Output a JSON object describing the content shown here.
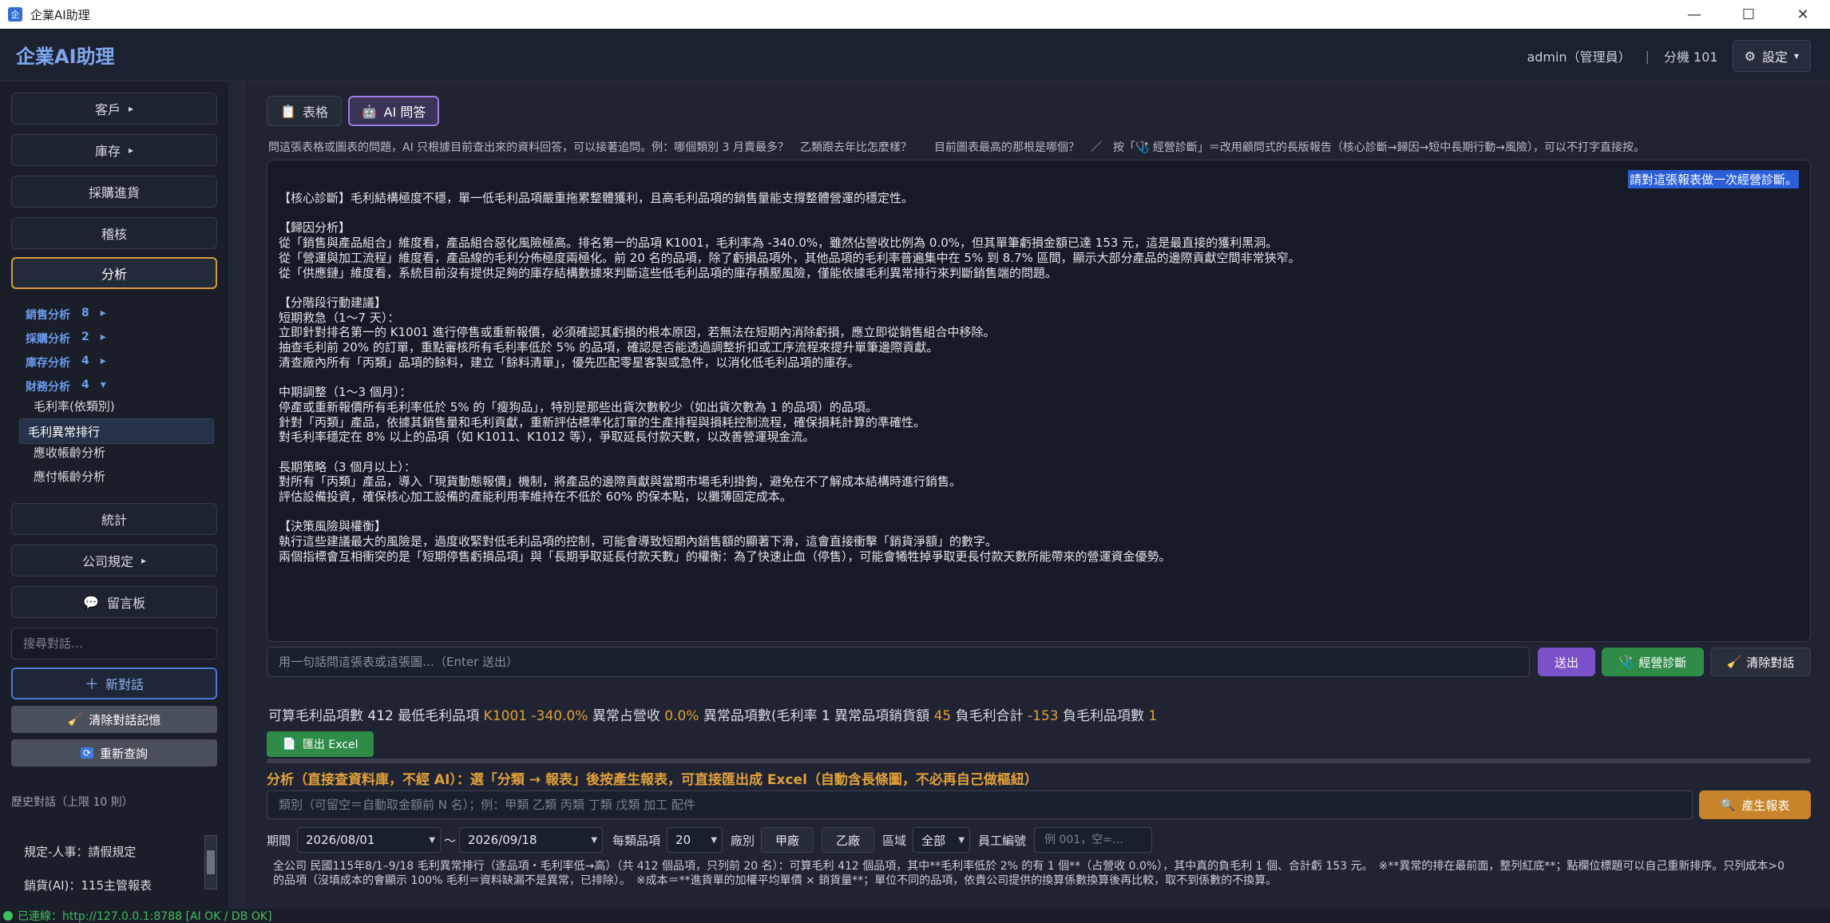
{
  "window": {
    "title": "企業AI助理"
  },
  "header": {
    "brand": "企業AI助理",
    "user": "admin（管理員）",
    "separator": "|",
    "branch": "分機 101",
    "settings_label": "設定",
    "settings_caret": "▾"
  },
  "sidebar": {
    "nav": [
      {
        "label": "客戶",
        "caret": "▸"
      },
      {
        "label": "庫存",
        "caret": "▸"
      },
      {
        "label": "採購進貨",
        "caret": ""
      },
      {
        "label": "稽核",
        "caret": ""
      },
      {
        "label": "分析",
        "caret": ""
      }
    ],
    "sub_groups": [
      {
        "label": "銷售分析",
        "count": "8",
        "caret": "▸"
      },
      {
        "label": "採購分析",
        "count": "2",
        "caret": "▸"
      },
      {
        "label": "庫存分析",
        "count": "4",
        "caret": "▸"
      },
      {
        "label": "財務分析",
        "count": "4",
        "caret": "▾"
      }
    ],
    "sub_items": [
      "毛利率(依類別)",
      "毛利異常排行",
      "應收帳齡分析",
      "應付帳齡分析"
    ],
    "nav2": [
      {
        "label": "統計",
        "caret": ""
      },
      {
        "label": "公司規定",
        "caret": "▸"
      },
      {
        "label": "留言板",
        "caret": ""
      }
    ],
    "search_placeholder": "搜尋對話…",
    "new_chat": "新對話",
    "clear_memory": "清除對話記憶",
    "requery": "重新查詢",
    "history_title": "歷史對話（上限 10 則）",
    "history": [
      "規定-人事：請假規定",
      "銷貨(AI)：115主管報表"
    ]
  },
  "main": {
    "tabs": [
      "表格",
      "AI 問答"
    ],
    "hint": "問這張表格或圖表的問題，AI 只根據目前查出來的資料回答，可以接著追問。例：哪個類別 3 月賣最多？　乙類跟去年比怎麼樣？　　目前圖表最高的那根是哪個？　／　按「🩺 經營診斷」＝改用顧問式的長版報告（核心診斷→歸因→短中長期行動→風險），可以不打字直接按。",
    "user_message": "請對這張報表做一次經營診斷。",
    "ai_lines": [
      "【核心診斷】毛利結構極度不穩，單一低毛利品項嚴重拖累整體獲利，且高毛利品項的銷售量能支撐整體營運的穩定性。",
      "",
      "【歸因分析】",
      "從「銷售與產品組合」維度看，產品組合惡化風險極高。排名第一的品項 K1001，毛利率為 -340.0%，雖然佔營收比例為 0.0%，但其單筆虧損金額已達 153 元，這是最直接的獲利黑洞。",
      "從「營運與加工流程」維度看，產品線的毛利分佈極度兩極化。前 20 名的品項，除了虧損品項外，其他品項的毛利率普遍集中在 5% 到 8.7% 區間，顯示大部分產品的邊際貢獻空間非常狹窄。",
      "從「供應鏈」維度看，系統目前沒有提供足夠的庫存結構數據來判斷這些低毛利品項的庫存積壓風險，僅能依據毛利異常排行來判斷銷售端的問題。",
      "",
      "【分階段行動建議】",
      "短期救急（1～7 天）：",
      "立即針對排名第一的 K1001 進行停售或重新報價，必須確認其虧損的根本原因，若無法在短期內消除虧損，應立即從銷售組合中移除。",
      "抽查毛利前 20% 的訂單，重點審核所有毛利率低於 5% 的品項，確認是否能透過調整折扣或工序流程來提升單筆邊際貢獻。",
      "清查廠內所有「丙類」品項的餘料，建立「餘料清單」，優先匹配零星客製或急件，以消化低毛利品項的庫存。",
      "",
      "中期調整（1～3 個月）：",
      "停產或重新報價所有毛利率低於 5% 的「瘦狗品」，特別是那些出貨次數較少（如出貨次數為 1 的品項）的品項。",
      "針對「丙類」產品，依據其銷售量和毛利貢獻，重新評估標準化訂單的生產排程與損耗控制流程，確保損耗計算的準確性。",
      "對毛利率穩定在 8% 以上的品項（如 K1011、K1012 等），爭取延長付款天數，以改善營運現金流。",
      "",
      "長期策略（3 個月以上）：",
      "對所有「丙類」產品，導入「現貨動態報價」機制，將產品的邊際貢獻與當期市場毛利掛鉤，避免在不了解成本結構時進行銷售。",
      "評估設備投資，確保核心加工設備的產能利用率維持在不低於 60% 的保本點，以攤薄固定成本。",
      "",
      "【決策風險與權衡】",
      "執行這些建議最大的風險是，過度收緊對低毛利品項的控制，可能會導致短期內銷售額的顯著下滑，這會直接衝擊「銷貨淨額」的數字。",
      "兩個指標會互相衝突的是「短期停售虧損品項」與「長期爭取延長付款天數」的權衡：為了快速止血（停售），可能會犧牲掉爭取更長付款天數所能帶來的營運資金優勢。"
    ],
    "ask_placeholder": "用一句話問這張表或這張圖…（Enter 送出）",
    "send": "送出",
    "diagnose": "經營診斷",
    "clear_chat": "清除對話",
    "summary": {
      "l1": "可算毛利品項數",
      "v1": "412",
      "l2": "最低毛利品項",
      "v2": "K1001 -340.0%",
      "l3": "異常占營收",
      "v3": "0.0%",
      "l4": "異常品項數(毛利率",
      "v4": "1",
      "l5": "異常品項銷貨額",
      "v5": "45",
      "l6": "負毛利合計",
      "v6": "-153",
      "l7": "負毛利品項數",
      "v7": "1"
    },
    "export_excel": "匯出 Excel",
    "analysis_title": "分析（直接查資料庫，不經 AI）：選「分類 → 報表」後按產生報表，可直接匯出成 Excel（自動含長條圖，不必再自己做樞紐）",
    "category_placeholder": "類別（可留空＝自動取金額前 N 名）；例：甲類 乙類 丙類 丁類 戊類 加工 配件",
    "generate": "產生報表",
    "filters": {
      "period_label": "期間",
      "date_from": "2026/08/01",
      "tilde": "～",
      "date_to": "2026/09/18",
      "per_cat_label": "每類品項",
      "per_cat": "20",
      "factory_label": "廠別",
      "factory_a": "甲廠",
      "factory_b": "乙廠",
      "region_label": "區域",
      "region": "全部",
      "employee_label": "員工編號",
      "employee_placeholder": "例 001，空=…"
    },
    "note": "全公司 民國115年8/1–9/18 毛利異常排行（逐品項・毛利率低→高）（共 412 個品項，只列前 20 名）：可算毛利 412 個品項，其中**毛利率低於 2% 的有 1 個**（占營收 0.0%），其中真的負毛利 1 個、合計虧 153 元。　※**異常的排在最前面，整列紅底**；點欄位標題可以自己重新排序。只列成本>0 的品項（沒填成本的會顯示 100% 毛利＝資料缺漏不是異常，已排除）。　※成本＝**進貨單的加權平均單價 × 銷貨量**；單位不同的品項，依貴公司提供的換算係數換算後再比較，取不到係數的不換算。"
  },
  "status": {
    "text": "已連線：http://127.0.0.1:8788  [AI OK / DB OK]"
  },
  "colors": {
    "accent": "#7fa7f0",
    "active_border": "#d39b3e",
    "ai_tab": "#9c7be0",
    "send": "#7b52c9",
    "diagnose": "#2e8b48",
    "generate": "#c8842a",
    "warning": "#e0a03a",
    "status_ok": "#3fbf5a"
  }
}
